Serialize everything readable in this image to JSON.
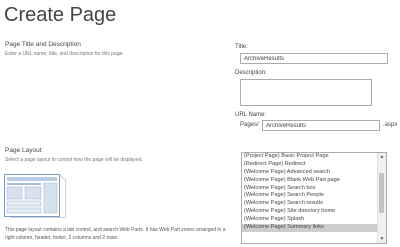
{
  "page": {
    "title": "Create Page"
  },
  "title_section": {
    "heading": "Page Title and Description",
    "description": "Enter a URL name, title, and description for this page."
  },
  "fields": {
    "title_label": "Title:",
    "title_value": "ArchiveResults",
    "description_label": "Description:",
    "url_name_label": "URL Name:",
    "url_prefix": "Pages/",
    "url_value": "ArchiveResults",
    "url_suffix": ".aspx"
  },
  "layout_section": {
    "heading": "Page Layout",
    "description": "Select a page layout to control how the page will be displayed.",
    "layout_description": "This page layout contains a tab control, and search Web Parts. It has Web Part zones arranged in a right column, header, footer, 2 columns and 2 rows.",
    "preview_icon": "page-layout-preview-icon"
  },
  "layouts": {
    "selected_index": 9,
    "scroll_position_percent": 30,
    "items": [
      {
        "label": "(Project Page) Basic Project Page"
      },
      {
        "label": "(Redirect Page) Redirect"
      },
      {
        "label": "(Welcome Page) Advanced search"
      },
      {
        "label": "(Welcome Page) Blank Web Part page"
      },
      {
        "label": "(Welcome Page) Search box"
      },
      {
        "label": "(Welcome Page) Search People"
      },
      {
        "label": "(Welcome Page) Search results"
      },
      {
        "label": "(Welcome Page) Site directory home"
      },
      {
        "label": "(Welcome Page) Splash"
      },
      {
        "label": "(Welcome Page) Summary links"
      }
    ]
  },
  "colors": {
    "selected_item": "#cdcdcd",
    "border": "#ababab"
  }
}
